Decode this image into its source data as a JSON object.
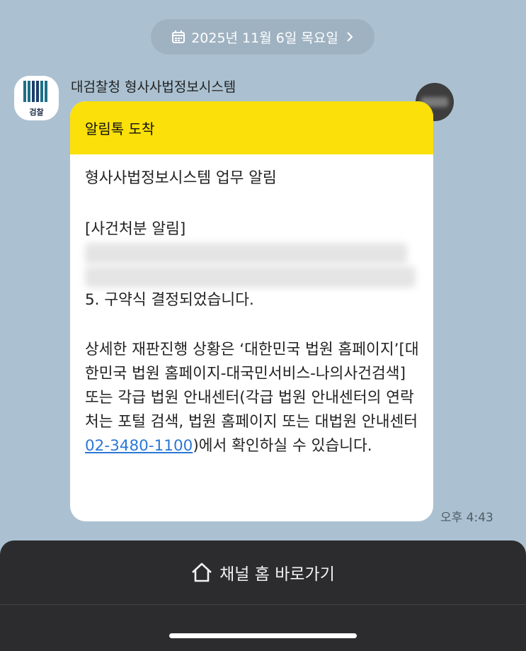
{
  "date_pill": {
    "label": "2025년 11월 6일 목요일",
    "icon": "calendar-icon",
    "chevron": "chevron-right-icon"
  },
  "sender": {
    "name": "대검찰청 형사사법정보시스템",
    "avatar_text": "검찰"
  },
  "message": {
    "header": "알림톡 도착",
    "title": "형사사법정보시스템 업무 알림",
    "section": "[사건처분 알림]",
    "result": "5. 구약식 결정되었습니다.",
    "detail_prefix": "상세한 재판진행 상황은 ‘대한민국 법원 홈페이지’[대한민국 법원 홈페이지-대국민서비스-나의사건검색] 또는 각급 법원 안내센터(각급 법원 안내센터의 연락처는 포털 검색, 법원 홈페이지 또는 대법원 안내센터 ",
    "phone": "02-3480-1100",
    "detail_suffix": ")에서 확인하실 수 있습니다.",
    "time": "오후 4:43"
  },
  "bottom": {
    "home_button": "채널 홈 바로가기",
    "home_icon": "house-icon"
  },
  "colors": {
    "background": "#abc1d1",
    "header_yellow": "#fbe00a",
    "link": "#2b78d6",
    "bottom_panel": "#2c2c2e"
  }
}
